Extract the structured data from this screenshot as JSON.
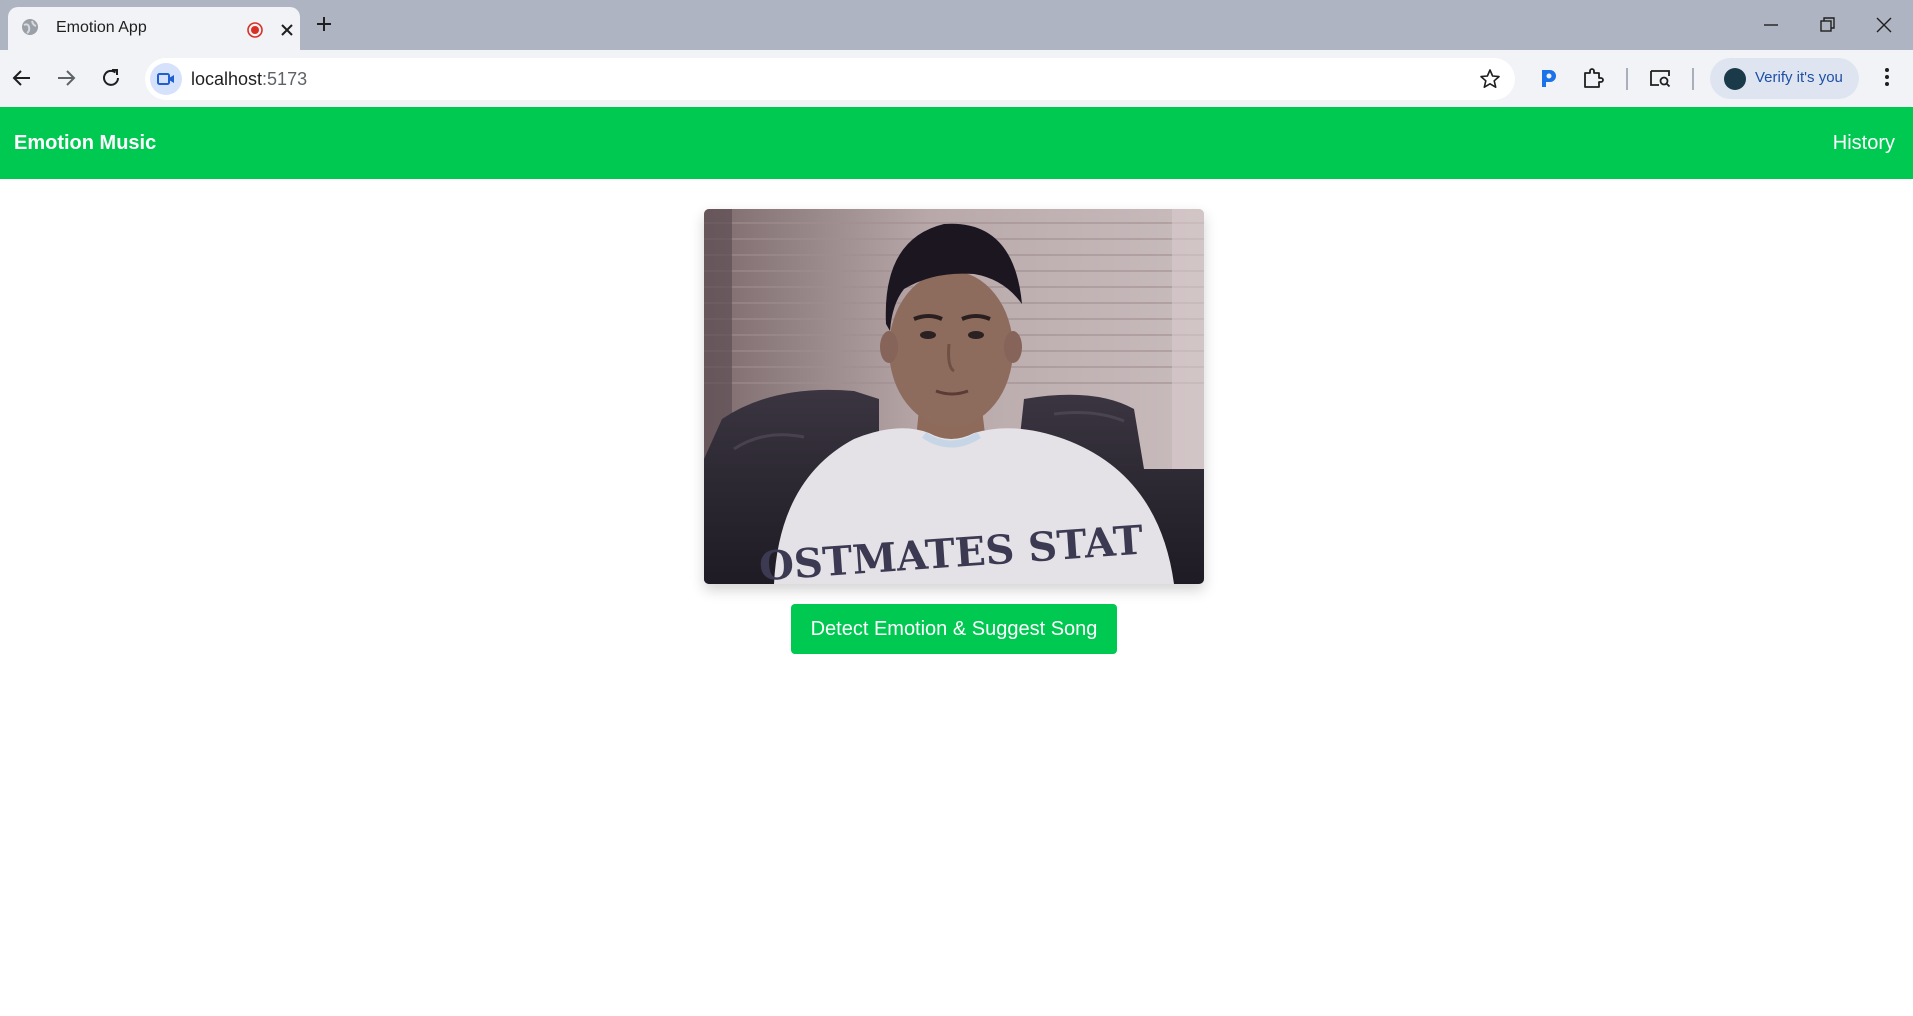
{
  "browser": {
    "tab_title": "Emotion App",
    "url_host": "localhost",
    "url_port": ":5173",
    "profile_button": "Verify it's you",
    "icons": {
      "favicon": "globe-icon",
      "recording": "recording-icon",
      "tab_close": "close-icon",
      "new_tab": "plus-icon",
      "back": "back-arrow-icon",
      "forward": "forward-arrow-icon",
      "reload": "reload-icon",
      "site_info": "camera-in-use-icon",
      "bookmark": "star-icon",
      "extension_p": "p-extension-icon",
      "extensions": "puzzle-icon",
      "tab_search": "tab-search-icon",
      "menu": "kebab-menu-icon"
    }
  },
  "app": {
    "brand": "Emotion Music",
    "nav_history": "History",
    "webcam_feed": "webcam-feed",
    "webcam_shirt_text": "OSTMATES STAT",
    "action_button": "Detect Emotion & Suggest Song",
    "colors": {
      "primary_green": "#00c951",
      "text_on_primary": "#ffffff"
    }
  }
}
